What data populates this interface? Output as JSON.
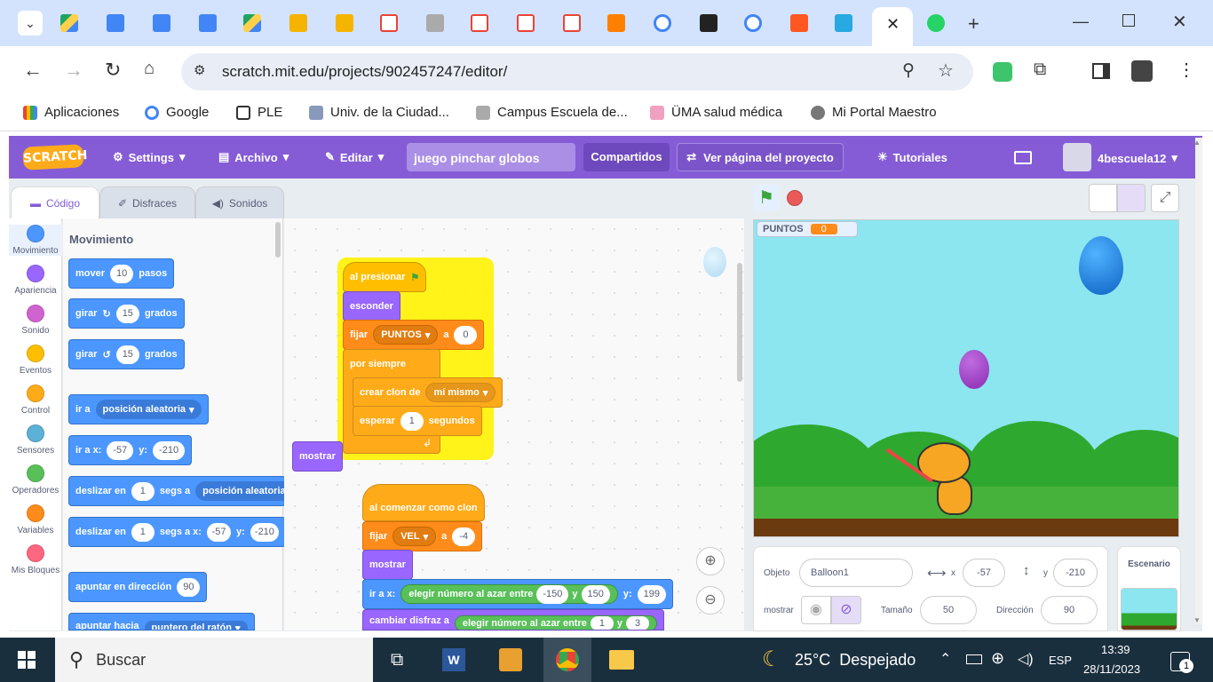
{
  "browser": {
    "url": "scratch.mit.edu/projects/902457247/editor/",
    "bookmarks": [
      "Aplicaciones",
      "Google",
      "PLE",
      "Univ. de la Ciudad...",
      "Campus Escuela de...",
      "ÜMA salud médica",
      "Mi Portal Maestro"
    ]
  },
  "scratch": {
    "logo": "SCRATCH",
    "menu": {
      "settings": "Settings",
      "file": "Archivo",
      "edit": "Editar",
      "tutorials": "Tutoriales",
      "user": "4bescuela12"
    },
    "project_title": "juego pinchar globos",
    "share": "Compartidos",
    "see_page": "Ver página del proyecto",
    "tabs": [
      "Código",
      "Disfraces",
      "Sonidos"
    ],
    "categories": [
      {
        "label": "Movimiento",
        "color": "#4c97ff"
      },
      {
        "label": "Apariencia",
        "color": "#9966ff"
      },
      {
        "label": "Sonido",
        "color": "#cf63cf"
      },
      {
        "label": "Eventos",
        "color": "#ffbf00"
      },
      {
        "label": "Control",
        "color": "#ffab19"
      },
      {
        "label": "Sensores",
        "color": "#5cb1d6"
      },
      {
        "label": "Operadores",
        "color": "#59c059"
      },
      {
        "label": "Variables",
        "color": "#ff8c1a"
      },
      {
        "label": "Mis Bloques",
        "color": "#ff6680"
      }
    ],
    "palette": {
      "heading": "Movimiento",
      "move": "mover",
      "move_n": "10",
      "steps": "pasos",
      "turn": "girar",
      "turn_n": "15",
      "degrees": "grados",
      "goto": "ir a",
      "random_pos": "posición aleatoria",
      "gotoxy": "ir a x:",
      "x": "-57",
      "y_label": "y:",
      "y": "-210",
      "glide": "deslizar en",
      "glide_n": "1",
      "secs_to": "segs a",
      "secs_tox": "segs a x:",
      "point_dir": "apuntar en dirección",
      "dir": "90",
      "point_toward": "apuntar hacia",
      "mouse": "puntero del ratón"
    },
    "script1": {
      "hat": "al presionar",
      "hide": "esconder",
      "set": "fijar",
      "var_points": "PUNTOS",
      "to": "a",
      "val0": "0",
      "forever": "por siempre",
      "create_clone": "crear clon de",
      "myself": "mí mismo",
      "wait": "esperar",
      "wait_n": "1",
      "seconds": "segundos"
    },
    "loose_show": "mostrar",
    "script2": {
      "hat": "al comenzar como clon",
      "set": "fijar",
      "var_vel": "VEL",
      "to": "a",
      "val": "-4",
      "show": "mostrar",
      "gotoxy": "ir a x:",
      "random": "elegir número al azar entre",
      "r1": "-150",
      "and": "y",
      "r2": "150",
      "y_label": "y:",
      "yv": "199",
      "costume": "cambiar disfraz a",
      "c1": "1",
      "c2": "3"
    },
    "stage": {
      "monitor_label": "PUNTOS",
      "monitor_value": "0"
    },
    "sprite_info": {
      "sprite_label": "Objeto",
      "sprite_name": "Balloon1",
      "x_label": "x",
      "x": "-57",
      "y_label": "y",
      "y": "-210",
      "show_label": "mostrar",
      "size_label": "Tamaño",
      "size": "50",
      "dir_label": "Dirección",
      "dir": "90"
    },
    "backdrop_label": "Escenario"
  },
  "taskbar": {
    "search": "Buscar",
    "weather": "25°C  Despejado",
    "lang": "ESP",
    "time": "13:39",
    "date": "28/11/2023",
    "notif": "1"
  }
}
